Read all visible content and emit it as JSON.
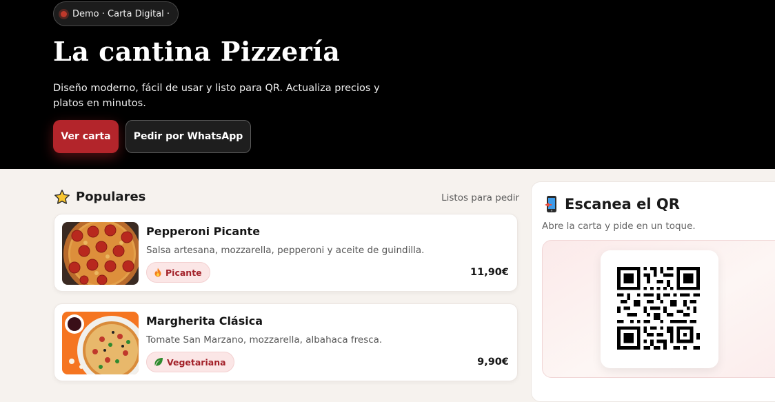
{
  "hero": {
    "badge": "Demo · Carta Digital ·",
    "title": "La cantina Pizzería",
    "subtitle": "Diseño moderno, fácil de usar y listo para QR. Actualiza precios y platos en minutos.",
    "primary_button": "Ver carta",
    "secondary_button": "Pedir por WhatsApp"
  },
  "popular": {
    "icon": "star-icon",
    "title": "Populares",
    "aside": "Listos para pedir",
    "items": [
      {
        "name": "Pepperoni Picante",
        "description": "Salsa artesana, mozzarella, pepperoni y aceite de guindilla.",
        "tag_icon": "fire-icon",
        "tag": "Picante",
        "price": "11,90€"
      },
      {
        "name": "Margherita Clásica",
        "description": "Tomate San Marzano, mozzarella, albahaca fresca.",
        "tag_icon": "leaf-icon",
        "tag": "Vegetariana",
        "price": "9,90€"
      }
    ]
  },
  "qr": {
    "icon": "phone-icon",
    "title": "Escanea el QR",
    "subtitle": "Abre la carta y pide en un toque."
  },
  "colors": {
    "accent": "#b3252b",
    "hero_bg": "#000000",
    "page_bg": "#f6f2ee",
    "tag_bg": "#fbe6e6"
  }
}
